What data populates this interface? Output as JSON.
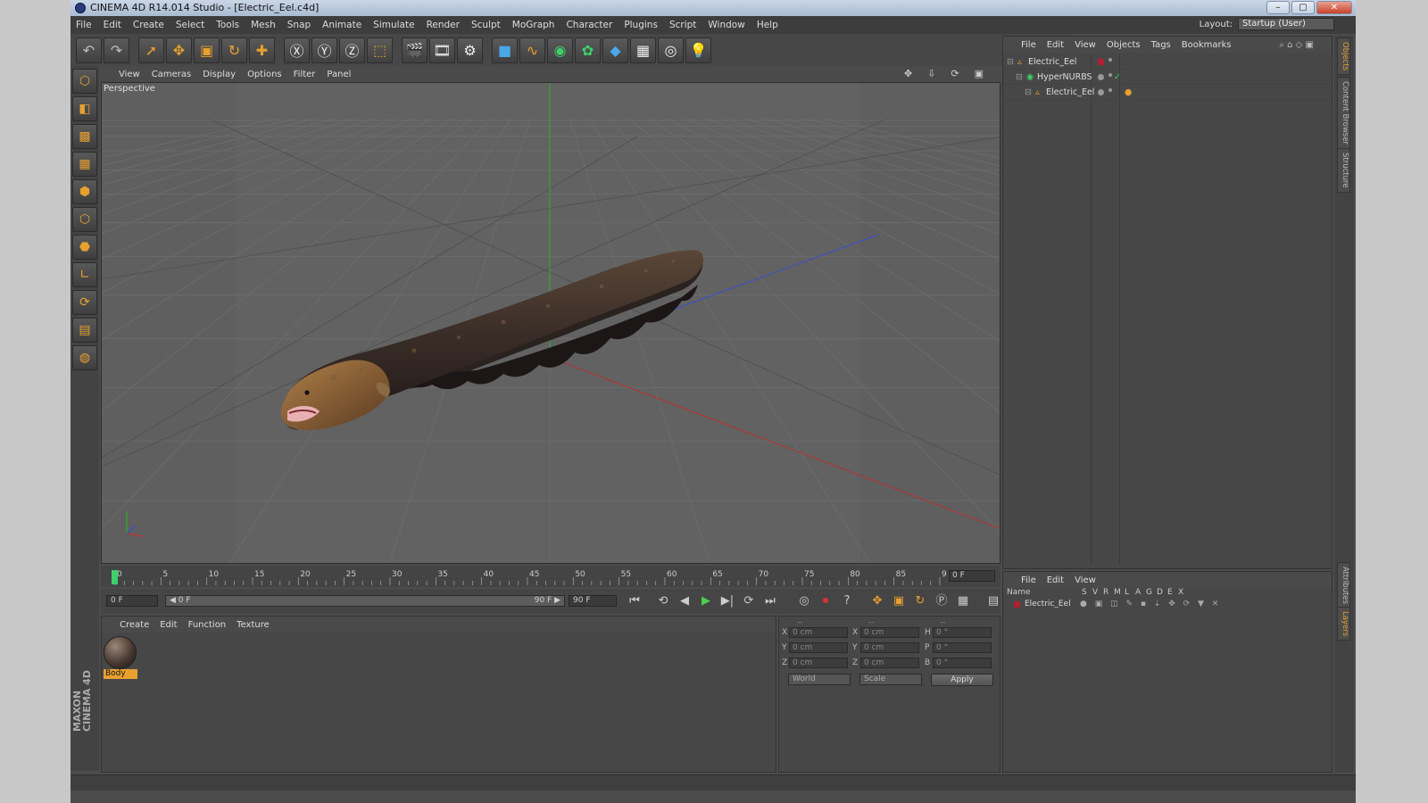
{
  "window": {
    "title": "CINEMA 4D R14.014 Studio - [Electric_Eel.c4d]",
    "buttons": [
      "–",
      "▢",
      "✕"
    ]
  },
  "menubar": [
    "File",
    "Edit",
    "Create",
    "Select",
    "Tools",
    "Mesh",
    "Snap",
    "Animate",
    "Simulate",
    "Render",
    "Sculpt",
    "MoGraph",
    "Character",
    "Plugins",
    "Script",
    "Window",
    "Help"
  ],
  "layout": {
    "label": "Layout:",
    "value": "Startup (User)"
  },
  "toolbar_icons": [
    "undo-icon",
    "redo-icon",
    "live-select-icon",
    "move-icon",
    "scale-icon",
    "rotate-icon",
    "add-object-icon",
    "lock-x-icon",
    "lock-y-icon",
    "lock-z-icon",
    "coordinate-system-icon",
    "render-view-icon",
    "render-picture-viewer-icon",
    "render-settings-icon",
    "cube-object-icon",
    "spline-icon",
    "nurbs-icon",
    "array-icon",
    "deformer-icon",
    "floor-icon",
    "camera-icon",
    "light-icon"
  ],
  "toolbar_glyphs": [
    "↶",
    "↷",
    "➚",
    "✥",
    "▣",
    "↻",
    "✚",
    "Ⓧ",
    "Ⓨ",
    "Ⓩ",
    "⬚",
    "🎬",
    "🎞",
    "⚙",
    "■",
    "∿",
    "◉",
    "✿",
    "◆",
    "▦",
    "◎",
    "💡"
  ],
  "left_tool_icons": [
    "make-editable-icon",
    "model-mode-icon",
    "texture-mode-icon",
    "workplane-icon",
    "points-mode-icon",
    "edges-mode-icon",
    "polygons-mode-icon",
    "axis-icon",
    "snap-icon",
    "grid-snap-icon",
    "locked-workplane-icon"
  ],
  "left_tool_glyphs": [
    "⬡",
    "◧",
    "▩",
    "▦",
    "⬢",
    "⬡",
    "⬣",
    "∟",
    "⟳",
    "▤",
    "◍"
  ],
  "brand": "MAXON CINEMA 4D",
  "viewport": {
    "menu": [
      "View",
      "Cameras",
      "Display",
      "Options",
      "Filter",
      "Panel"
    ],
    "label": "Perspective",
    "nav_icons": [
      "✥",
      "⇩",
      "⟳",
      "▣"
    ]
  },
  "timeline": {
    "ticks": [
      0,
      5,
      10,
      15,
      20,
      25,
      30,
      35,
      40,
      45,
      50,
      55,
      60,
      65,
      70,
      75,
      80,
      85,
      90
    ],
    "current_frame": "0 F"
  },
  "anim": {
    "start": "0 F",
    "slider_left": "◀ 0 F",
    "slider_right": "90 F ▶",
    "end": "90 F",
    "controls": [
      "⏮",
      "⟲",
      "◀",
      "▶",
      "▶|",
      "⟳",
      "⏭"
    ],
    "keys": [
      "◎",
      "⏺",
      "?",
      "✥",
      "▣",
      "↻",
      "Ⓟ",
      "▦",
      "▤"
    ]
  },
  "material_manager": {
    "menu": [
      "Create",
      "Edit",
      "Function",
      "Texture"
    ],
    "material": "Body"
  },
  "coordinates": {
    "headers": [
      "--",
      "--",
      "--"
    ],
    "rows": [
      {
        "axis": "X",
        "pos": "0 cm",
        "axis2": "X",
        "size": "0 cm",
        "rot_axis": "H",
        "rot": "0 °"
      },
      {
        "axis": "Y",
        "pos": "0 cm",
        "axis2": "Y",
        "size": "0 cm",
        "rot_axis": "P",
        "rot": "0 °"
      },
      {
        "axis": "Z",
        "pos": "0 cm",
        "axis2": "Z",
        "size": "0 cm",
        "rot_axis": "B",
        "rot": "0 °"
      }
    ],
    "world": "World",
    "scale": "Scale",
    "apply": "Apply"
  },
  "object_manager": {
    "menu": [
      "File",
      "Edit",
      "View",
      "Objects",
      "Tags",
      "Bookmarks"
    ],
    "objects": [
      {
        "name": "Electric_Eel",
        "indent": 0
      },
      {
        "name": "HyperNURBS",
        "indent": 1
      },
      {
        "name": "Electric_Eel",
        "indent": 2
      }
    ]
  },
  "layer_manager": {
    "menu": [
      "File",
      "Edit",
      "View"
    ],
    "columns": [
      "Name",
      "S",
      "V",
      "R",
      "M",
      "L",
      "A",
      "G",
      "D",
      "E",
      "X"
    ],
    "layers": [
      {
        "name": "Electric_Eel",
        "color": "#b02030"
      }
    ]
  },
  "right_tabs": [
    "Objects",
    "Content Browser",
    "Structure",
    "Attributes",
    "Layers"
  ],
  "colors": {
    "accent": "#e8a030",
    "panel": "#474747",
    "viewport": "#5d5d5d",
    "x_axis": "#c03030",
    "y_axis": "#30b030",
    "z_axis": "#3050d0"
  }
}
